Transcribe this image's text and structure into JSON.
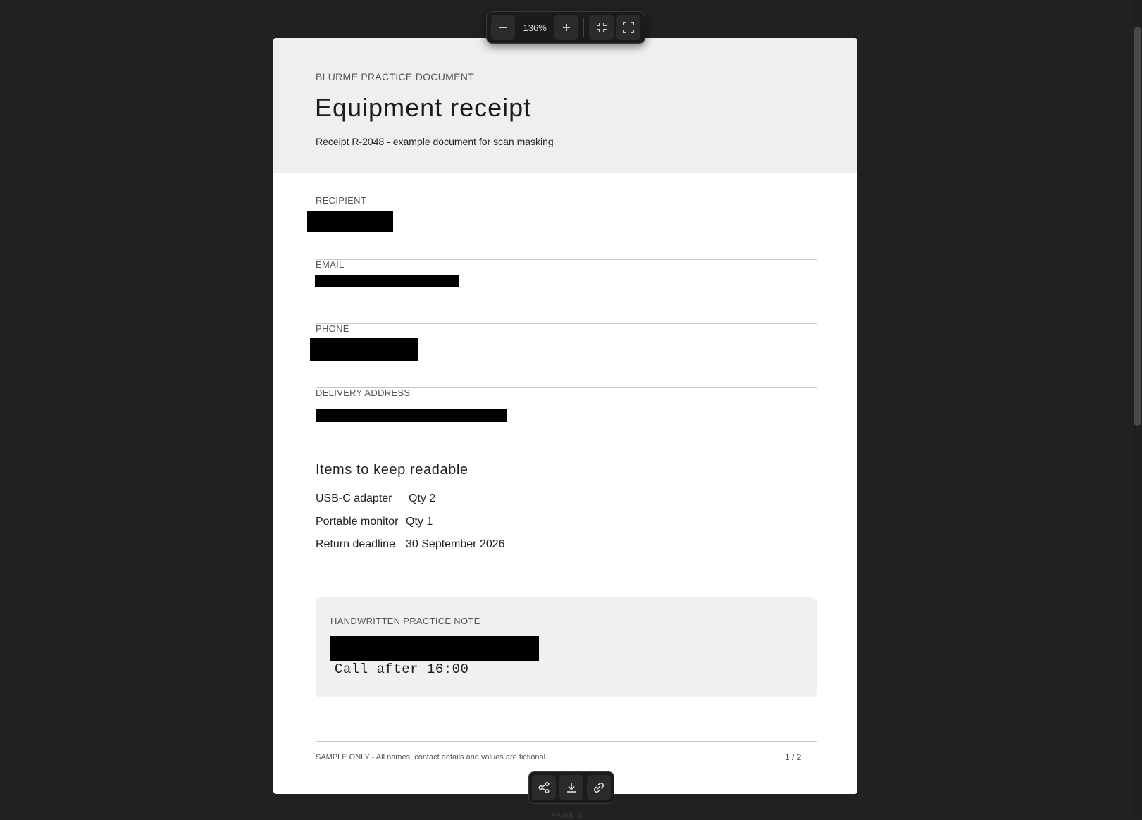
{
  "toolbar": {
    "zoom_level": "136%",
    "zoom_out_icon": "minus-icon",
    "zoom_in_icon": "plus-icon",
    "fit_icon": "collapse-icon",
    "fullscreen_icon": "expand-icon"
  },
  "document": {
    "eyebrow": "BLURME PRACTICE DOCUMENT",
    "title": "Equipment receipt",
    "subtitle": "Receipt R-2048 - example document for scan masking",
    "fields": [
      {
        "label": "RECIPIENT",
        "value_redacted": true
      },
      {
        "label": "EMAIL",
        "value_redacted": true
      },
      {
        "label": "PHONE",
        "value_redacted": true
      },
      {
        "label": "DELIVERY ADDRESS",
        "value_redacted": true
      }
    ],
    "items_heading": "Items to keep readable",
    "items": [
      {
        "name": "USB-C adapter",
        "value": "Qty 2"
      },
      {
        "name": "Portable monitor",
        "value": "Qty 1"
      },
      {
        "name": "Return deadline",
        "value": "30 September 2026"
      }
    ],
    "note": {
      "label": "HANDWRITTEN PRACTICE NOTE",
      "text": "Call after 16:00"
    },
    "footer_text": "SAMPLE ONLY - All names, contact details and values are fictional.",
    "page_number": "1 / 2"
  },
  "actions": {
    "share_icon": "share-icon",
    "download_icon": "download-icon",
    "link_icon": "link-icon"
  },
  "next_page_label": "PAGE 2",
  "colors": {
    "background": "#212121",
    "page": "#ffffff",
    "header": "#efefef",
    "redaction": "#000000"
  }
}
